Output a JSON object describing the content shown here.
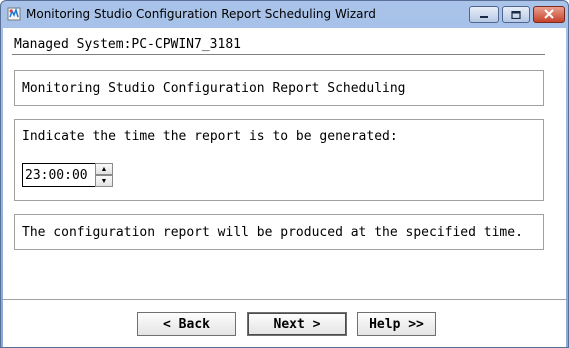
{
  "window": {
    "title": "Monitoring Studio Configuration Report Scheduling Wizard"
  },
  "header": {
    "managed_system": "Managed System:PC-CPWIN7_3181"
  },
  "section_title": "Monitoring Studio Configuration Report Scheduling",
  "time_panel": {
    "prompt": "Indicate the time the report is to be generated:",
    "time_value": "23:00:00"
  },
  "info_panel": {
    "message": "The configuration report will be produced at the specified time."
  },
  "buttons": {
    "back": "< Back",
    "next": "Next >",
    "help": "Help >>"
  },
  "colors": {
    "titlebar": "#a9c3e9",
    "close_button": "#c6412a"
  }
}
